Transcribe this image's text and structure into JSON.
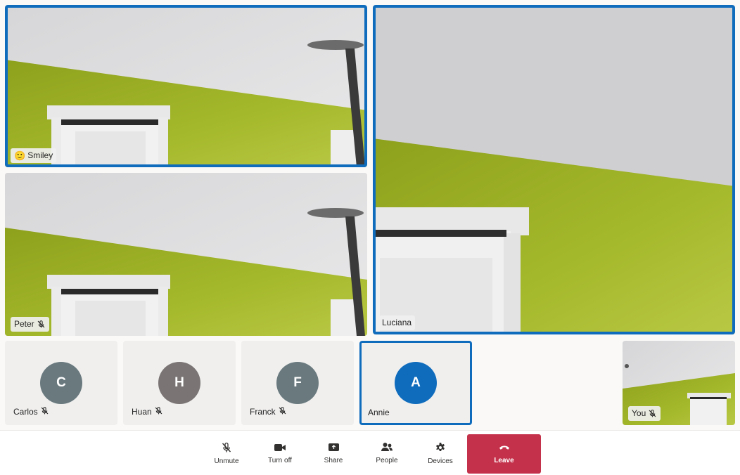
{
  "participants": {
    "smiley": {
      "name": "Smiley",
      "emoji": "🙂",
      "speaking": true
    },
    "peter": {
      "name": "Peter",
      "muted": true
    },
    "luciana": {
      "name": "Luciana",
      "speaking": true
    },
    "carlos": {
      "name": "Carlos",
      "initial": "C",
      "avatar_color": "#69797e",
      "muted": true
    },
    "huan": {
      "name": "Huan",
      "initial": "H",
      "avatar_color": "#7a7574",
      "muted": true
    },
    "franck": {
      "name": "Franck",
      "initial": "F",
      "avatar_color": "#69797e",
      "muted": true
    },
    "annie": {
      "name": "Annie",
      "initial": "A",
      "avatar_color": "#0f6cbd",
      "speaking": true
    },
    "self": {
      "name": "You",
      "muted": true
    }
  },
  "controls": {
    "unmute": {
      "label": "Unmute",
      "icon": "mic-off-icon"
    },
    "camera": {
      "label": "Turn off",
      "icon": "video-camera-icon"
    },
    "share": {
      "label": "Share",
      "icon": "share-screen-icon"
    },
    "people": {
      "label": "People",
      "icon": "people-icon"
    },
    "devices": {
      "label": "Devices",
      "icon": "gear-icon"
    },
    "leave": {
      "label": "Leave",
      "icon": "hang-up-icon"
    }
  },
  "colors": {
    "speaking_border": "#0f6cbd",
    "leave_button": "#c4314b",
    "wall": "#95aa1c",
    "ceiling": "#dcdcdc"
  }
}
